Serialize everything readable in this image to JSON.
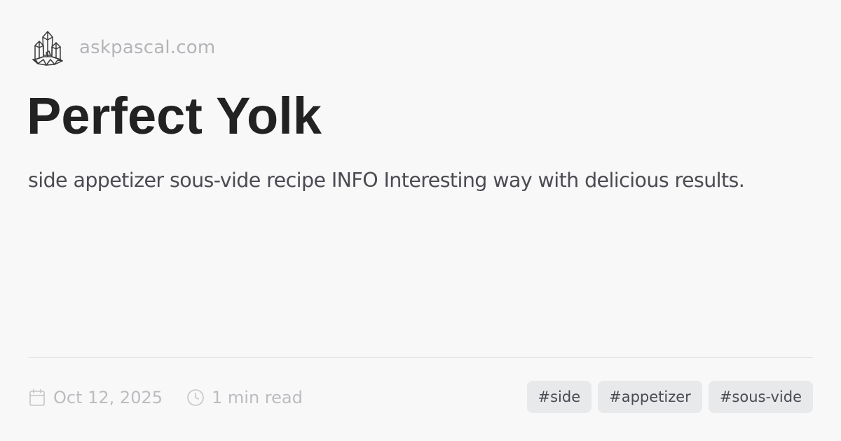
{
  "site": {
    "logo_icon": "crystal-cluster-icon",
    "name": "askpascal.com"
  },
  "post": {
    "title": "Perfect Yolk",
    "description": "side appetizer sous-vide recipe INFO Interesting way with delicious results."
  },
  "meta": {
    "date_icon": "calendar-icon",
    "date": "Oct 12, 2025",
    "read_time_icon": "clock-icon",
    "read_time": "1 min read"
  },
  "tags": [
    "#side",
    "#appetizer",
    "#sous-vide"
  ],
  "colors": {
    "background": "#f9f8f9",
    "title": "#222222",
    "description": "#4b4b52",
    "muted": "#b4b4b8",
    "tag_background": "#e8e9eb",
    "tag_text": "#4a4a52",
    "divider": "#e3e3e6"
  }
}
